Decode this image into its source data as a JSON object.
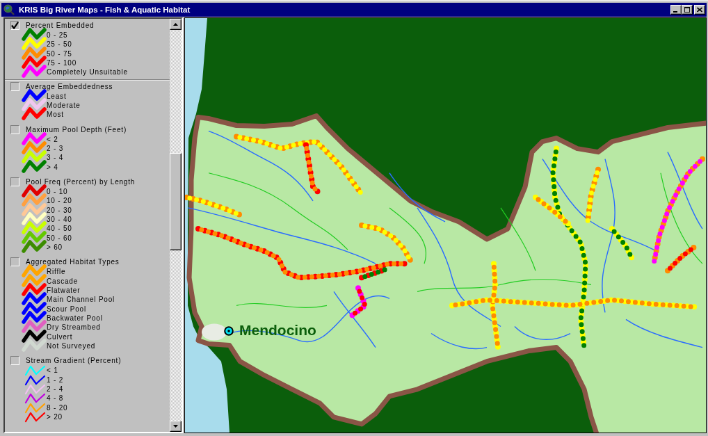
{
  "window": {
    "title": "KRIS Big River Maps - Fish & Aquatic Habitat"
  },
  "legend": {
    "layers": [
      {
        "title": "Percent Embedded",
        "checked": true,
        "active": true,
        "kind": "thick",
        "classes": [
          {
            "label": "0 - 25",
            "color": "#008000"
          },
          {
            "label": "25 - 50",
            "color": "#ffff00"
          },
          {
            "label": "50 - 75",
            "color": "#ff8c00"
          },
          {
            "label": "75 - 100",
            "color": "#ff0000"
          },
          {
            "label": "Completely Unsuitable",
            "color": "#ff00ff"
          }
        ]
      },
      {
        "title": "Average Embeddedness",
        "checked": false,
        "active": false,
        "kind": "thick",
        "classes": [
          {
            "label": "Least",
            "color": "#0000ff"
          },
          {
            "label": "Moderate",
            "color": "#f0c8f0"
          },
          {
            "label": "Most",
            "color": "#ff0000"
          }
        ]
      },
      {
        "title": "Maximum Pool Depth (Feet)",
        "checked": false,
        "active": false,
        "kind": "thick",
        "classes": [
          {
            "label": "< 2",
            "color": "#ff00ff"
          },
          {
            "label": "2 - 3",
            "color": "#ff8c00"
          },
          {
            "label": "3 - 4",
            "color": "#c8ff00"
          },
          {
            "label": "> 4",
            "color": "#008000"
          }
        ]
      },
      {
        "title": "Pool Freq (Percent) by Length",
        "checked": false,
        "active": false,
        "kind": "thick",
        "classes": [
          {
            "label": "0 - 10",
            "color": "#e00000"
          },
          {
            "label": "10 - 20",
            "color": "#ffa040"
          },
          {
            "label": "20 - 30",
            "color": "#ffc896"
          },
          {
            "label": "30 - 40",
            "color": "#ffffc0"
          },
          {
            "label": "40 - 50",
            "color": "#c8ff00"
          },
          {
            "label": "50 - 60",
            "color": "#64c800"
          },
          {
            "label": "> 60",
            "color": "#3c8c00"
          }
        ]
      },
      {
        "title": "Aggregated Habitat Types",
        "checked": false,
        "active": false,
        "kind": "thick",
        "classes": [
          {
            "label": "Riffle",
            "color": "#ffa500"
          },
          {
            "label": "Cascade",
            "color": "#ffa500"
          },
          {
            "label": "Flatwater",
            "color": "#ff0000"
          },
          {
            "label": "Main Channel Pool",
            "color": "#0000ff"
          },
          {
            "label": "Scour Pool",
            "color": "#0000ff"
          },
          {
            "label": "Backwater Pool",
            "color": "#0000ff"
          },
          {
            "label": "Dry Streambed",
            "color": "#e060c0"
          },
          {
            "label": "Culvert",
            "color": "#000000"
          },
          {
            "label": "Not Surveyed",
            "color": "#d0d8d0"
          }
        ]
      },
      {
        "title": "Stream Gradient (Percent)",
        "checked": false,
        "active": false,
        "kind": "thin",
        "classes": [
          {
            "label": "< 1",
            "color": "#00ffff"
          },
          {
            "label": "1 - 2",
            "color": "#0000ff"
          },
          {
            "label": "2 - 4",
            "color": "#f0c0f0"
          },
          {
            "label": "4 - 8",
            "color": "#c000e0"
          },
          {
            "label": "8 - 20",
            "color": "#ffa000"
          },
          {
            "label": "> 20",
            "color": "#ff0000"
          }
        ]
      }
    ]
  },
  "map": {
    "place_label": "Mendocino"
  }
}
